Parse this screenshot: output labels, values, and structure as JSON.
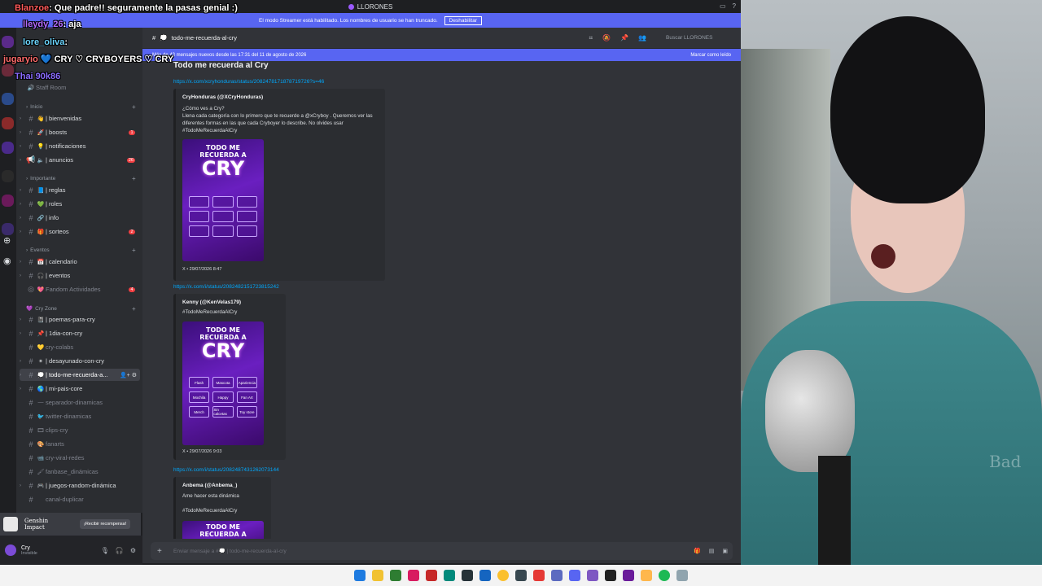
{
  "window": {
    "title": "LLORONES"
  },
  "banner": {
    "text": "El modo Streamer está habilitado. Los nombres de usuario se han truncado.",
    "button": "Deshabilitar"
  },
  "header": {
    "channel": "todo-me-recuerda-al-cry",
    "search_placeholder": "Buscar LLORONES"
  },
  "newbar": {
    "text": "Más de 43 mensajes nuevos desde las 17:31 del 11 de agosto de 2026",
    "mark": "Marcar como leído"
  },
  "sidebar": {
    "top_items": [
      {
        "label": "Staff Room"
      }
    ],
    "categories": {
      "inicio": "Inicio",
      "importante": "Importante",
      "eventos": "Eventos",
      "cryzone": "Cry Zone"
    },
    "channels": {
      "bienvenidas": "| bienvenidas",
      "boosts": "| boosts",
      "notificaciones": "| notificaciones",
      "anuncios": "| anuncios",
      "reglas": "| reglas",
      "roles": "| roles",
      "info": "| info",
      "sorteos": "| sorteos",
      "calendario": "| calendario",
      "eventos": "| eventos",
      "fandom": "Fandom Actividades",
      "poemas": "| poemas-para-cry",
      "dia": "| 1dia-con-cry",
      "colabs": "cry-colabs",
      "desayunado": "| desayunado-con-cry",
      "todo": "| todo-me-recuerda-a...",
      "pais": "| mi-pais-core",
      "separador": "separador-dinamicas",
      "twitter": "twitter-dinamicas",
      "clips": "clips-cry",
      "fanarts": "fanarts",
      "viral": "cry-viral-redes",
      "fanbase": "fanbase_dinámicas",
      "juegos": "| juegos-random-dinámica",
      "canal": "canal-duplicar"
    },
    "counts": {
      "boosts": "1",
      "anuncios": "26",
      "sorteos": "2",
      "fandom": "4"
    }
  },
  "promo": {
    "game": "Genshin Impact",
    "cta": "¡Recibir recompensa!"
  },
  "user": {
    "name": "Cry",
    "status": "Invisible"
  },
  "messages": {
    "title": "Todo me recuerda al Cry",
    "link1": "https://x.com/xcryhonduras/status/2082478171878719726?s=46",
    "embed1": {
      "author": "CryHonduras (@XCryHonduras)",
      "q": "¿Cómo ves a Cry?",
      "body": "Llena cada categoría con lo primero que te recuerde a @xCryboy . Queremos ver las diferentes formas en las que cada Cryboyer lo describe. No olvides usar #TodoMeRecuerdaAlCry",
      "foot": "X • 29/07/2026 8:47"
    },
    "link2": "https://x.com/i/status/2082482151723815242",
    "embed2": {
      "author": "Kenny (@KenVelas179)",
      "body": "#TodoMeRecuerdaAlCry",
      "foot": "X • 29/07/2026 9:03"
    },
    "link3": "https://x.com/i/status/2082487431262073144",
    "embed3": {
      "author": "Anbema (@Anbema_)",
      "body": "Ame hacer esta dinámica",
      "tag": "#TodoMeRecuerdaAlCry"
    },
    "img": {
      "line1": "TODO ME",
      "line2": "RECUERDA A",
      "line3": "CRY",
      "cells": [
        "Flash",
        "Mascota",
        "Apariencia",
        "Mochila",
        "Happy",
        "Fan Art",
        "Merch",
        "Sin calcetas",
        "Toy store"
      ]
    }
  },
  "composer": {
    "placeholder": "Enviar mensaje a #💭 | todo-me-recuerda-al-cry"
  },
  "chat": [
    {
      "user": "Blanzoe",
      "text": ": Que padre!! seguramente la pasas genial :)",
      "color": "#ff5a5a"
    },
    {
      "user": "lleydy_26",
      "text": ": aja",
      "color": "#b36bff"
    },
    {
      "user": "lore_oliva",
      "text": ":",
      "color": "#6bd6ff"
    },
    {
      "user": "jugaryio",
      "text": "💙 CRY ♡ CRYBOYERS ♡ CRY",
      "color": "#ff6b6b"
    },
    {
      "user": "Thai 90k86",
      "text": "",
      "color": "#8a6bff"
    }
  ]
}
